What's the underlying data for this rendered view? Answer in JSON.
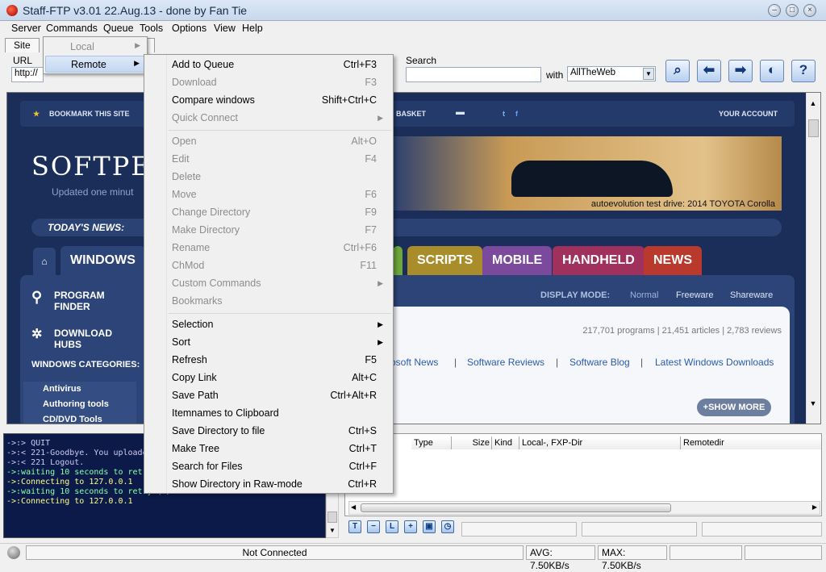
{
  "window": {
    "title": "Staff-FTP v3.01 22.Aug.13 - done by Fan Tie",
    "buttons": [
      "minimize",
      "maximize",
      "close"
    ]
  },
  "menubar": [
    "Server",
    "Commands",
    "Queue",
    "Tools",
    "Options",
    "View",
    "Help"
  ],
  "tabs": [
    "Site"
  ],
  "toolbar": {
    "url_label": "URL",
    "url_value": "http://",
    "search_label": "Search",
    "search_value": "",
    "with_label": "with",
    "engine_value": "AllTheWeb",
    "icons": [
      "search-icon",
      "arrow-left-icon",
      "arrow-right-icon",
      "stop-icon",
      "help-icon"
    ]
  },
  "submenu": {
    "items": [
      {
        "label": "Local",
        "has_arrow": true,
        "highlighted": false
      },
      {
        "label": "Remote",
        "has_arrow": true,
        "highlighted": true
      }
    ]
  },
  "context_menu": {
    "items": [
      {
        "label": "Add to Queue",
        "shortcut": "Ctrl+F3",
        "enabled": true
      },
      {
        "label": "Download",
        "shortcut": "F3",
        "enabled": false
      },
      {
        "label": "Compare windows",
        "shortcut": "Shift+Ctrl+C",
        "enabled": true
      },
      {
        "label": "Quick Connect",
        "shortcut": "",
        "submenu": true,
        "enabled": false
      },
      {
        "separator": true
      },
      {
        "label": "Open",
        "shortcut": "Alt+O",
        "enabled": false
      },
      {
        "label": "Edit",
        "shortcut": "F4",
        "enabled": false
      },
      {
        "label": "Delete",
        "shortcut": "",
        "enabled": false
      },
      {
        "label": "Move",
        "shortcut": "F6",
        "enabled": false
      },
      {
        "label": "Change Directory",
        "shortcut": "F9",
        "enabled": false
      },
      {
        "label": "Make Directory",
        "shortcut": "F7",
        "enabled": false
      },
      {
        "label": "Rename",
        "shortcut": "Ctrl+F6",
        "enabled": false
      },
      {
        "label": "ChMod",
        "shortcut": "F11",
        "enabled": false
      },
      {
        "label": "Custom Commands",
        "shortcut": "",
        "submenu": true,
        "enabled": false
      },
      {
        "label": "Bookmarks",
        "shortcut": "",
        "enabled": false
      },
      {
        "separator": true
      },
      {
        "label": "Selection",
        "shortcut": "",
        "submenu": true,
        "enabled": true
      },
      {
        "label": "Sort",
        "shortcut": "",
        "submenu": true,
        "enabled": true
      },
      {
        "label": "Refresh",
        "shortcut": "F5",
        "enabled": true
      },
      {
        "label": "Copy Link",
        "shortcut": "Alt+C",
        "enabled": true
      },
      {
        "label": "Save Path",
        "shortcut": "Ctrl+Alt+R",
        "enabled": true
      },
      {
        "label": "Itemnames to Clipboard",
        "shortcut": "",
        "enabled": true
      },
      {
        "label": "Save Directory to file",
        "shortcut": "Ctrl+S",
        "enabled": true
      },
      {
        "label": "Make Tree",
        "shortcut": "Ctrl+T",
        "enabled": true
      },
      {
        "label": "Search for Files",
        "shortcut": "Ctrl+F",
        "enabled": true
      },
      {
        "label": "Show Directory in Raw-mode",
        "shortcut": "Ctrl+R",
        "enabled": true
      }
    ]
  },
  "browser": {
    "top_links": [
      "BOOKMARK THIS SITE",
      "BASKET",
      "YOUR ACCOUNT"
    ],
    "logo": "SOFTPE",
    "updated": "Updated one minut",
    "banner_caption": "autoevolution test drive: 2014 TOYOTA Corolla",
    "todays_news": "TODAY'S NEWS:",
    "nav_tabs": [
      {
        "label": "WINDOWS",
        "color": "#2c4477"
      },
      {
        "label": "SCRIPTS",
        "color": "#a88d2a"
      },
      {
        "label": "MOBILE",
        "color": "#7b4a9c"
      },
      {
        "label": "HANDHELD",
        "color": "#a0305c"
      },
      {
        "label": "NEWS",
        "color": "#b93a2c"
      }
    ],
    "side_links": [
      "PROGRAM FINDER",
      "DOWNLOAD HUBS"
    ],
    "categories_label": "WINDOWS CATEGORIES:",
    "categories": [
      "Antivirus",
      "Authoring tools",
      "CD/DVD Tools"
    ],
    "display_mode_label": "DISPLAY MODE:",
    "display_modes": [
      "Normal",
      "Freeware",
      "Shareware"
    ],
    "stats": "217,701 programs | 21,451 articles | 2,783 reviews",
    "links": [
      "osoft News",
      "Software Reviews",
      "Software Blog",
      "Latest Windows Downloads"
    ],
    "show_more": "+SHOW MORE"
  },
  "log": {
    "lines": [
      "->:> QUIT",
      "->:< 221-Goodbye. You uploaded 0 a",
      "->:< 221 Logout.",
      "->:waiting 10 seconds to retry (1/",
      "->:Connecting to 127.0.0.1",
      "->:waiting 10 seconds to retry (2/",
      "->:Connecting to 127.0.0.1"
    ]
  },
  "filelist": {
    "columns": [
      "Type",
      "Size",
      "Kind",
      "Local-, FXP-Dir",
      "Remotedir"
    ]
  },
  "bottom_icons": [
    "T",
    "−",
    "L",
    "+",
    "save",
    "clock"
  ],
  "status": {
    "connection": "Not Connected",
    "avg": "AVG: 7.50KB/s",
    "max": "MAX: 7.50KB/s"
  }
}
